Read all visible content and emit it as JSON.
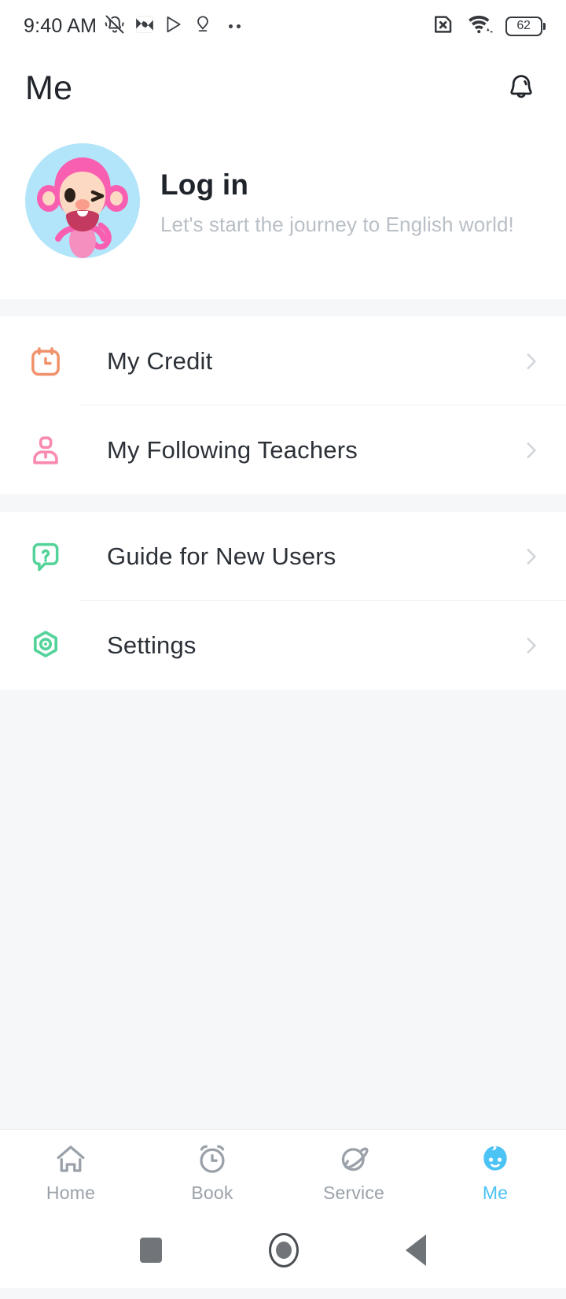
{
  "status_bar": {
    "time": "9:40 AM",
    "left_icons": [
      "bell-mute-icon",
      "broken-image-icon",
      "play-store-icon",
      "location-pin-icon",
      "more-dots-icon"
    ],
    "right_icons": [
      "sim-card-error-icon",
      "wifi-icon",
      "battery-icon"
    ],
    "battery_percent": "62"
  },
  "header": {
    "title": "Me",
    "notification_icon": "bell-icon"
  },
  "profile": {
    "avatar": "monkey-mascot-avatar",
    "title": "Log in",
    "subtitle": "Let's start the journey to English world!"
  },
  "menu": {
    "groups": [
      {
        "items": [
          {
            "label": "My Credit",
            "icon": "calendar-clock-icon",
            "icon_color": "#f0916a",
            "chevron": "chevron-right-icon"
          },
          {
            "label": "My Following Teachers",
            "icon": "person-icon",
            "icon_color": "#fa8bb0",
            "chevron": "chevron-right-icon"
          }
        ]
      },
      {
        "items": [
          {
            "label": "Guide for New Users",
            "icon": "question-bubble-icon",
            "icon_color": "#53d39a",
            "chevron": "chevron-right-icon"
          },
          {
            "label": "Settings",
            "icon": "hexagon-gear-icon",
            "icon_color": "#53d39a",
            "chevron": "chevron-right-icon"
          }
        ]
      }
    ]
  },
  "tabbar": {
    "active_color": "#4cc3f5",
    "inactive_color": "#9aa1a9",
    "tabs": [
      {
        "label": "Home",
        "icon": "home-icon",
        "active": false
      },
      {
        "label": "Book",
        "icon": "alarm-clock-icon",
        "active": false
      },
      {
        "label": "Service",
        "icon": "planet-icon",
        "active": false
      },
      {
        "label": "Me",
        "icon": "baby-face-icon",
        "active": true
      }
    ]
  },
  "android_nav": {
    "recents": "square-icon",
    "home": "circle-icon",
    "back": "triangle-back-icon"
  }
}
